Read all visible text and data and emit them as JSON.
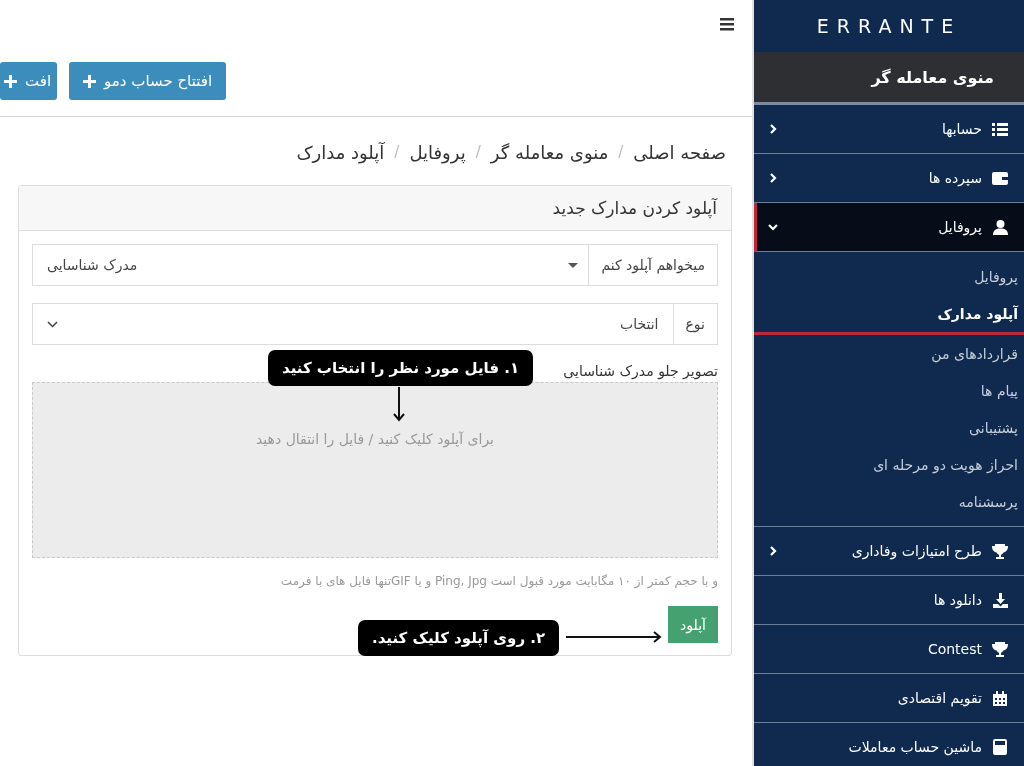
{
  "topbar": {
    "actions": [
      {
        "label": "افتتاح حساب دمو"
      },
      {
        "label": "افت"
      }
    ]
  },
  "breadcrumb": {
    "separator": "/",
    "items": [
      "صفحه اصلی",
      "منوی معامله گر",
      "پروفایل",
      "آپلود مدارک"
    ]
  },
  "card": {
    "title": "آپلود کردن مدارک جدید",
    "fields": [
      {
        "kind": "dropdown",
        "addon": "میخواهم آپلود کنم",
        "value": "مدرک شناسایی"
      },
      {
        "kind": "select",
        "addon": "نوع",
        "value": "انتخاب"
      }
    ],
    "upload": {
      "label": "تصویر جلو مدرک شناسایی",
      "dropzone": "برای آپلود کلیک کنید / فایل را انتقال دهید",
      "help": "و با حجم کمتر از ۱۰ مگابایت مورد قبول است Ping, Jpg و یا GIFتنها فایل های با فرمت",
      "button": "آپلود"
    }
  },
  "annotations": [
    {
      "kind": "down",
      "text": "۱. فایل مورد نظر را انتخاب کنید"
    },
    {
      "kind": "right",
      "text": "۲. روی آپلود کلیک کنید."
    }
  ],
  "sidebar": {
    "logo": "ERRANTE",
    "header": "منوی معامله گر",
    "items": [
      {
        "label": "حسابها",
        "expandable": true,
        "expanded": false,
        "selected": false
      },
      {
        "label": "سپرده ها",
        "expandable": true,
        "expanded": false,
        "selected": false
      },
      {
        "label": "پروفایل",
        "expandable": true,
        "expanded": true,
        "selected": true,
        "children": [
          {
            "label": "پروفایل",
            "selected": false
          },
          {
            "label": "آپلود مدارک",
            "selected": true
          },
          {
            "label": "قراردادهای من",
            "selected": false
          },
          {
            "label": "پیام ها",
            "selected": false
          },
          {
            "label": "پشتیبانی",
            "selected": false
          },
          {
            "label": "احراز هویت دو مرحله ای",
            "selected": false
          },
          {
            "label": "پرسشنامه",
            "selected": false
          }
        ]
      },
      {
        "label": "طرح امتیازات وفاداری",
        "expandable": true,
        "expanded": false,
        "selected": false
      },
      {
        "label": "دانلود ها",
        "expandable": false,
        "selected": false
      },
      {
        "label": "Contest",
        "expandable": false,
        "selected": false
      },
      {
        "label": "تقویم اقتصادی",
        "expandable": false,
        "selected": false
      },
      {
        "label": "ماشین حساب معاملات",
        "expandable": false,
        "selected": false
      }
    ]
  }
}
